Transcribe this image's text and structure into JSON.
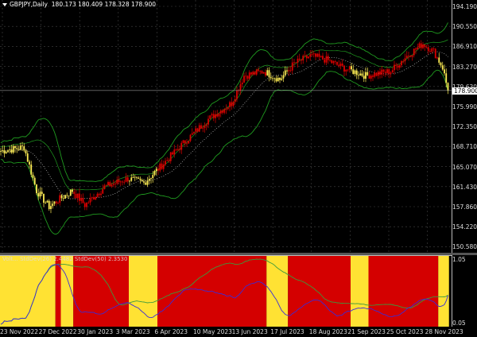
{
  "header": {
    "symbol": "GBPJPY,Daily",
    "ohlc": "180.173 180.409 178.328 178.900"
  },
  "indicator": {
    "label": "Volt... StdDev(26) 2.4482  StdDev(50) 2.3530",
    "max_label": "1.05",
    "min_label": "0.05"
  },
  "price_axis": [
    "194.190",
    "190.550",
    "186.910",
    "183.270",
    "179.630",
    "175.990",
    "172.350",
    "168.710",
    "165.070",
    "161.430",
    "157.860",
    "154.220",
    "150.580"
  ],
  "current_price": "178.900",
  "dates": [
    "23 Nov 2022",
    "27 Dec 2022",
    "30 Jan 2023",
    "3 Mar 2023",
    "6 Apr 2023",
    "10 May 2023",
    "13 Jun 2023",
    "17 Jul 2023",
    "18 Aug 2023",
    "21 Sep 2023",
    "25 Oct 2023",
    "28 Nov 2023"
  ],
  "colors": {
    "bull": "#ffee55",
    "bear": "#dd0000",
    "band": "#1f9a1f",
    "regime_yellow": "#ffe233",
    "regime_red": "#d40000",
    "line_blue": "#3a2bd8",
    "line_green": "#3c9a3c"
  },
  "chart_data": {
    "type": "candlestick",
    "price_range": [
      150.58,
      194.19
    ],
    "keypoints": [
      [
        0,
        167.9
      ],
      [
        13,
        168.6
      ],
      [
        20,
        160.7
      ],
      [
        27,
        157.8
      ],
      [
        33,
        159.2
      ],
      [
        40,
        160.7
      ],
      [
        47,
        158.1
      ],
      [
        58,
        161.4
      ],
      [
        71,
        162.9
      ],
      [
        80,
        162.1
      ],
      [
        89,
        165.0
      ],
      [
        102,
        169.3
      ],
      [
        116,
        173.7
      ],
      [
        129,
        176.6
      ],
      [
        136,
        181.6
      ],
      [
        147,
        182.4
      ],
      [
        156,
        180.9
      ],
      [
        164,
        183.8
      ],
      [
        173,
        185.2
      ],
      [
        182,
        184.5
      ],
      [
        191,
        183.1
      ],
      [
        204,
        181.6
      ],
      [
        218,
        182.4
      ],
      [
        227,
        185.2
      ],
      [
        236,
        187.4
      ],
      [
        242,
        186.0
      ],
      [
        247,
        183.1
      ],
      [
        250,
        178.9
      ]
    ],
    "regimes": [
      [
        "yellow",
        0,
        31
      ],
      [
        "red",
        31,
        34
      ],
      [
        "yellow",
        34,
        41
      ],
      [
        "red",
        41,
        72
      ],
      [
        "yellow",
        72,
        88
      ],
      [
        "red",
        88,
        149
      ],
      [
        "yellow",
        149,
        161
      ],
      [
        "red",
        161,
        196
      ],
      [
        "yellow",
        196,
        206
      ],
      [
        "red",
        206,
        245
      ],
      [
        "yellow",
        245,
        251
      ]
    ]
  }
}
